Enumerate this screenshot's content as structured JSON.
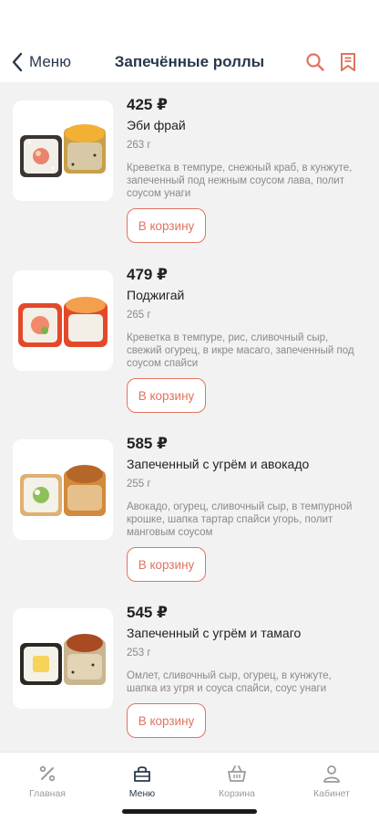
{
  "header": {
    "back_label": "Меню",
    "title": "Запечённые роллы"
  },
  "products": [
    {
      "price": "425 ₽",
      "name": "Эби фрай",
      "weight": "263 г",
      "description": "Креветка в темпуре, снежный краб, в кунжуте, запеченный под нежным соусом лава, полит соусом унаги",
      "button_label": "В корзину"
    },
    {
      "price": "479 ₽",
      "name": "Поджигай",
      "weight": "265 г",
      "description": "Креветка в темпуре, рис, сливочный сыр, свежий огурец, в икре масаго, запеченный под соусом спайси",
      "button_label": "В корзину"
    },
    {
      "price": "585 ₽",
      "name": "Запеченный с угрём и авокадо",
      "weight": "255 г",
      "description": "Авокадо, огурец, сливочный сыр, в темпурной крошке, шапка тартар спайси угорь,  полит манговым соусом",
      "button_label": "В корзину"
    },
    {
      "price": "545 ₽",
      "name": "Запеченный с угрём и тамаго",
      "weight": "253 г",
      "description": "Омлет, сливочный сыр, огурец, в кунжуте, шапка из угря и соуса спайси, соус унаги",
      "button_label": "В корзину"
    }
  ],
  "tabbar": {
    "items": [
      {
        "label": "Главная",
        "icon": "discount-icon"
      },
      {
        "label": "Меню",
        "icon": "menu-bag-icon"
      },
      {
        "label": "Корзина",
        "icon": "basket-icon"
      },
      {
        "label": "Кабинет",
        "icon": "user-icon"
      }
    ],
    "active": "Меню"
  },
  "colors": {
    "accent": "#e0735f",
    "title": "#27384a",
    "muted": "#8a8a8a",
    "background": "#f2f2f2"
  }
}
